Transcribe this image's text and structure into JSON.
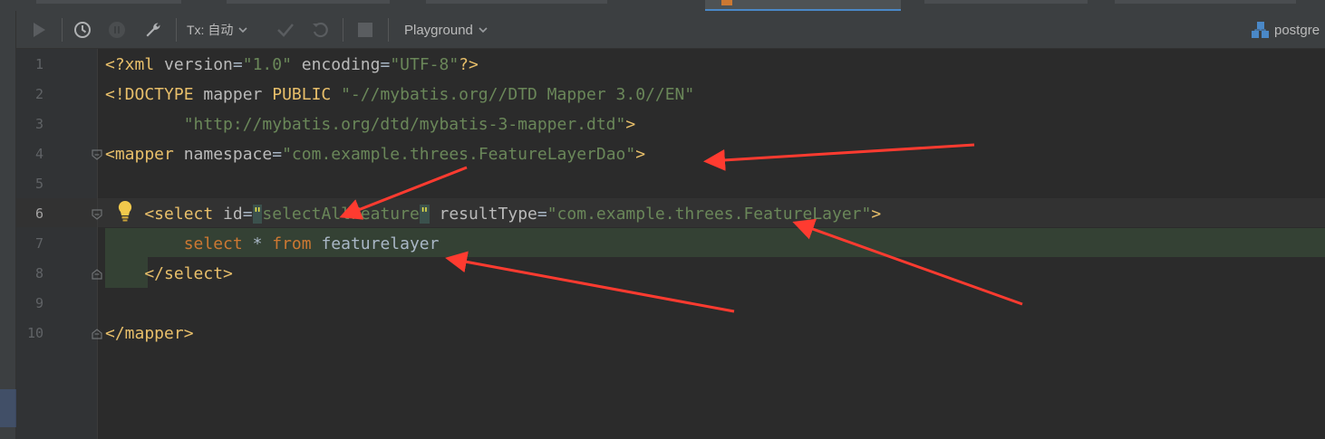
{
  "toolbar": {
    "tx_label": "Tx: 自动",
    "playground_label": "Playground",
    "datasource_label": "postgre"
  },
  "editor": {
    "line_numbers": [
      "1",
      "2",
      "3",
      "4",
      "5",
      "6",
      "7",
      "8",
      "9",
      "10"
    ],
    "lines": [
      {
        "tokens": [
          {
            "t": "<?xml ",
            "c": "tag"
          },
          {
            "t": "version",
            "c": "attr"
          },
          {
            "t": "=",
            "c": "txt"
          },
          {
            "t": "\"1.0\"",
            "c": "val"
          },
          {
            "t": " encoding",
            "c": "attr"
          },
          {
            "t": "=",
            "c": "txt"
          },
          {
            "t": "\"UTF-8\"",
            "c": "val"
          },
          {
            "t": "?>",
            "c": "tag"
          }
        ]
      },
      {
        "tokens": [
          {
            "t": "<!DOCTYPE ",
            "c": "tag"
          },
          {
            "t": "mapper ",
            "c": "attr"
          },
          {
            "t": "PUBLIC ",
            "c": "tag"
          },
          {
            "t": "\"-//mybatis.org//DTD Mapper 3.0//EN\"",
            "c": "val"
          }
        ]
      },
      {
        "tokens": [
          {
            "t": "        \"http://mybatis.org/dtd/mybatis-3-mapper.dtd\"",
            "c": "val"
          },
          {
            "t": ">",
            "c": "tag"
          }
        ]
      },
      {
        "tokens": [
          {
            "t": "<mapper ",
            "c": "tag"
          },
          {
            "t": "namespace",
            "c": "attr"
          },
          {
            "t": "=",
            "c": "txt"
          },
          {
            "t": "\"com.example.threes.FeatureLayerDao\"",
            "c": "val"
          },
          {
            "t": ">",
            "c": "tag"
          }
        ]
      },
      {
        "tokens": []
      },
      {
        "tokens": [
          {
            "t": "    <select ",
            "c": "tag"
          },
          {
            "t": "id",
            "c": "attr"
          },
          {
            "t": "=",
            "c": "txt"
          },
          {
            "t": "\"",
            "c": "qhl"
          },
          {
            "t": "selectAllFeature",
            "c": "val"
          },
          {
            "t": "\"",
            "c": "qhl"
          },
          {
            "t": " resultType",
            "c": "attr"
          },
          {
            "t": "=",
            "c": "txt"
          },
          {
            "t": "\"com.example.threes.FeatureLayer\"",
            "c": "val"
          },
          {
            "t": ">",
            "c": "tag"
          }
        ]
      },
      {
        "tokens": [
          {
            "t": "        select ",
            "c": "kw"
          },
          {
            "t": "* ",
            "c": "txt"
          },
          {
            "t": "from ",
            "c": "kw"
          },
          {
            "t": "featurelayer",
            "c": "txt"
          }
        ]
      },
      {
        "tokens": [
          {
            "t": "    </select>",
            "c": "tag"
          }
        ]
      },
      {
        "tokens": []
      },
      {
        "tokens": [
          {
            "t": "</mapper>",
            "c": "tag"
          }
        ]
      }
    ]
  },
  "colors": {
    "editor_bg": "#2b2b2b",
    "toolbar_bg": "#3c3f41",
    "tag": "#e8bf6a",
    "string": "#6a8759",
    "keyword": "#cc7832",
    "arrow": "#ff3b30"
  },
  "icons": [
    "run-icon",
    "history-icon",
    "cancel-icon",
    "wrench-icon",
    "chevron-down-icon",
    "check-icon",
    "rollback-icon",
    "stop-icon",
    "datasource-icon",
    "lightbulb-icon",
    "fold-icon"
  ]
}
